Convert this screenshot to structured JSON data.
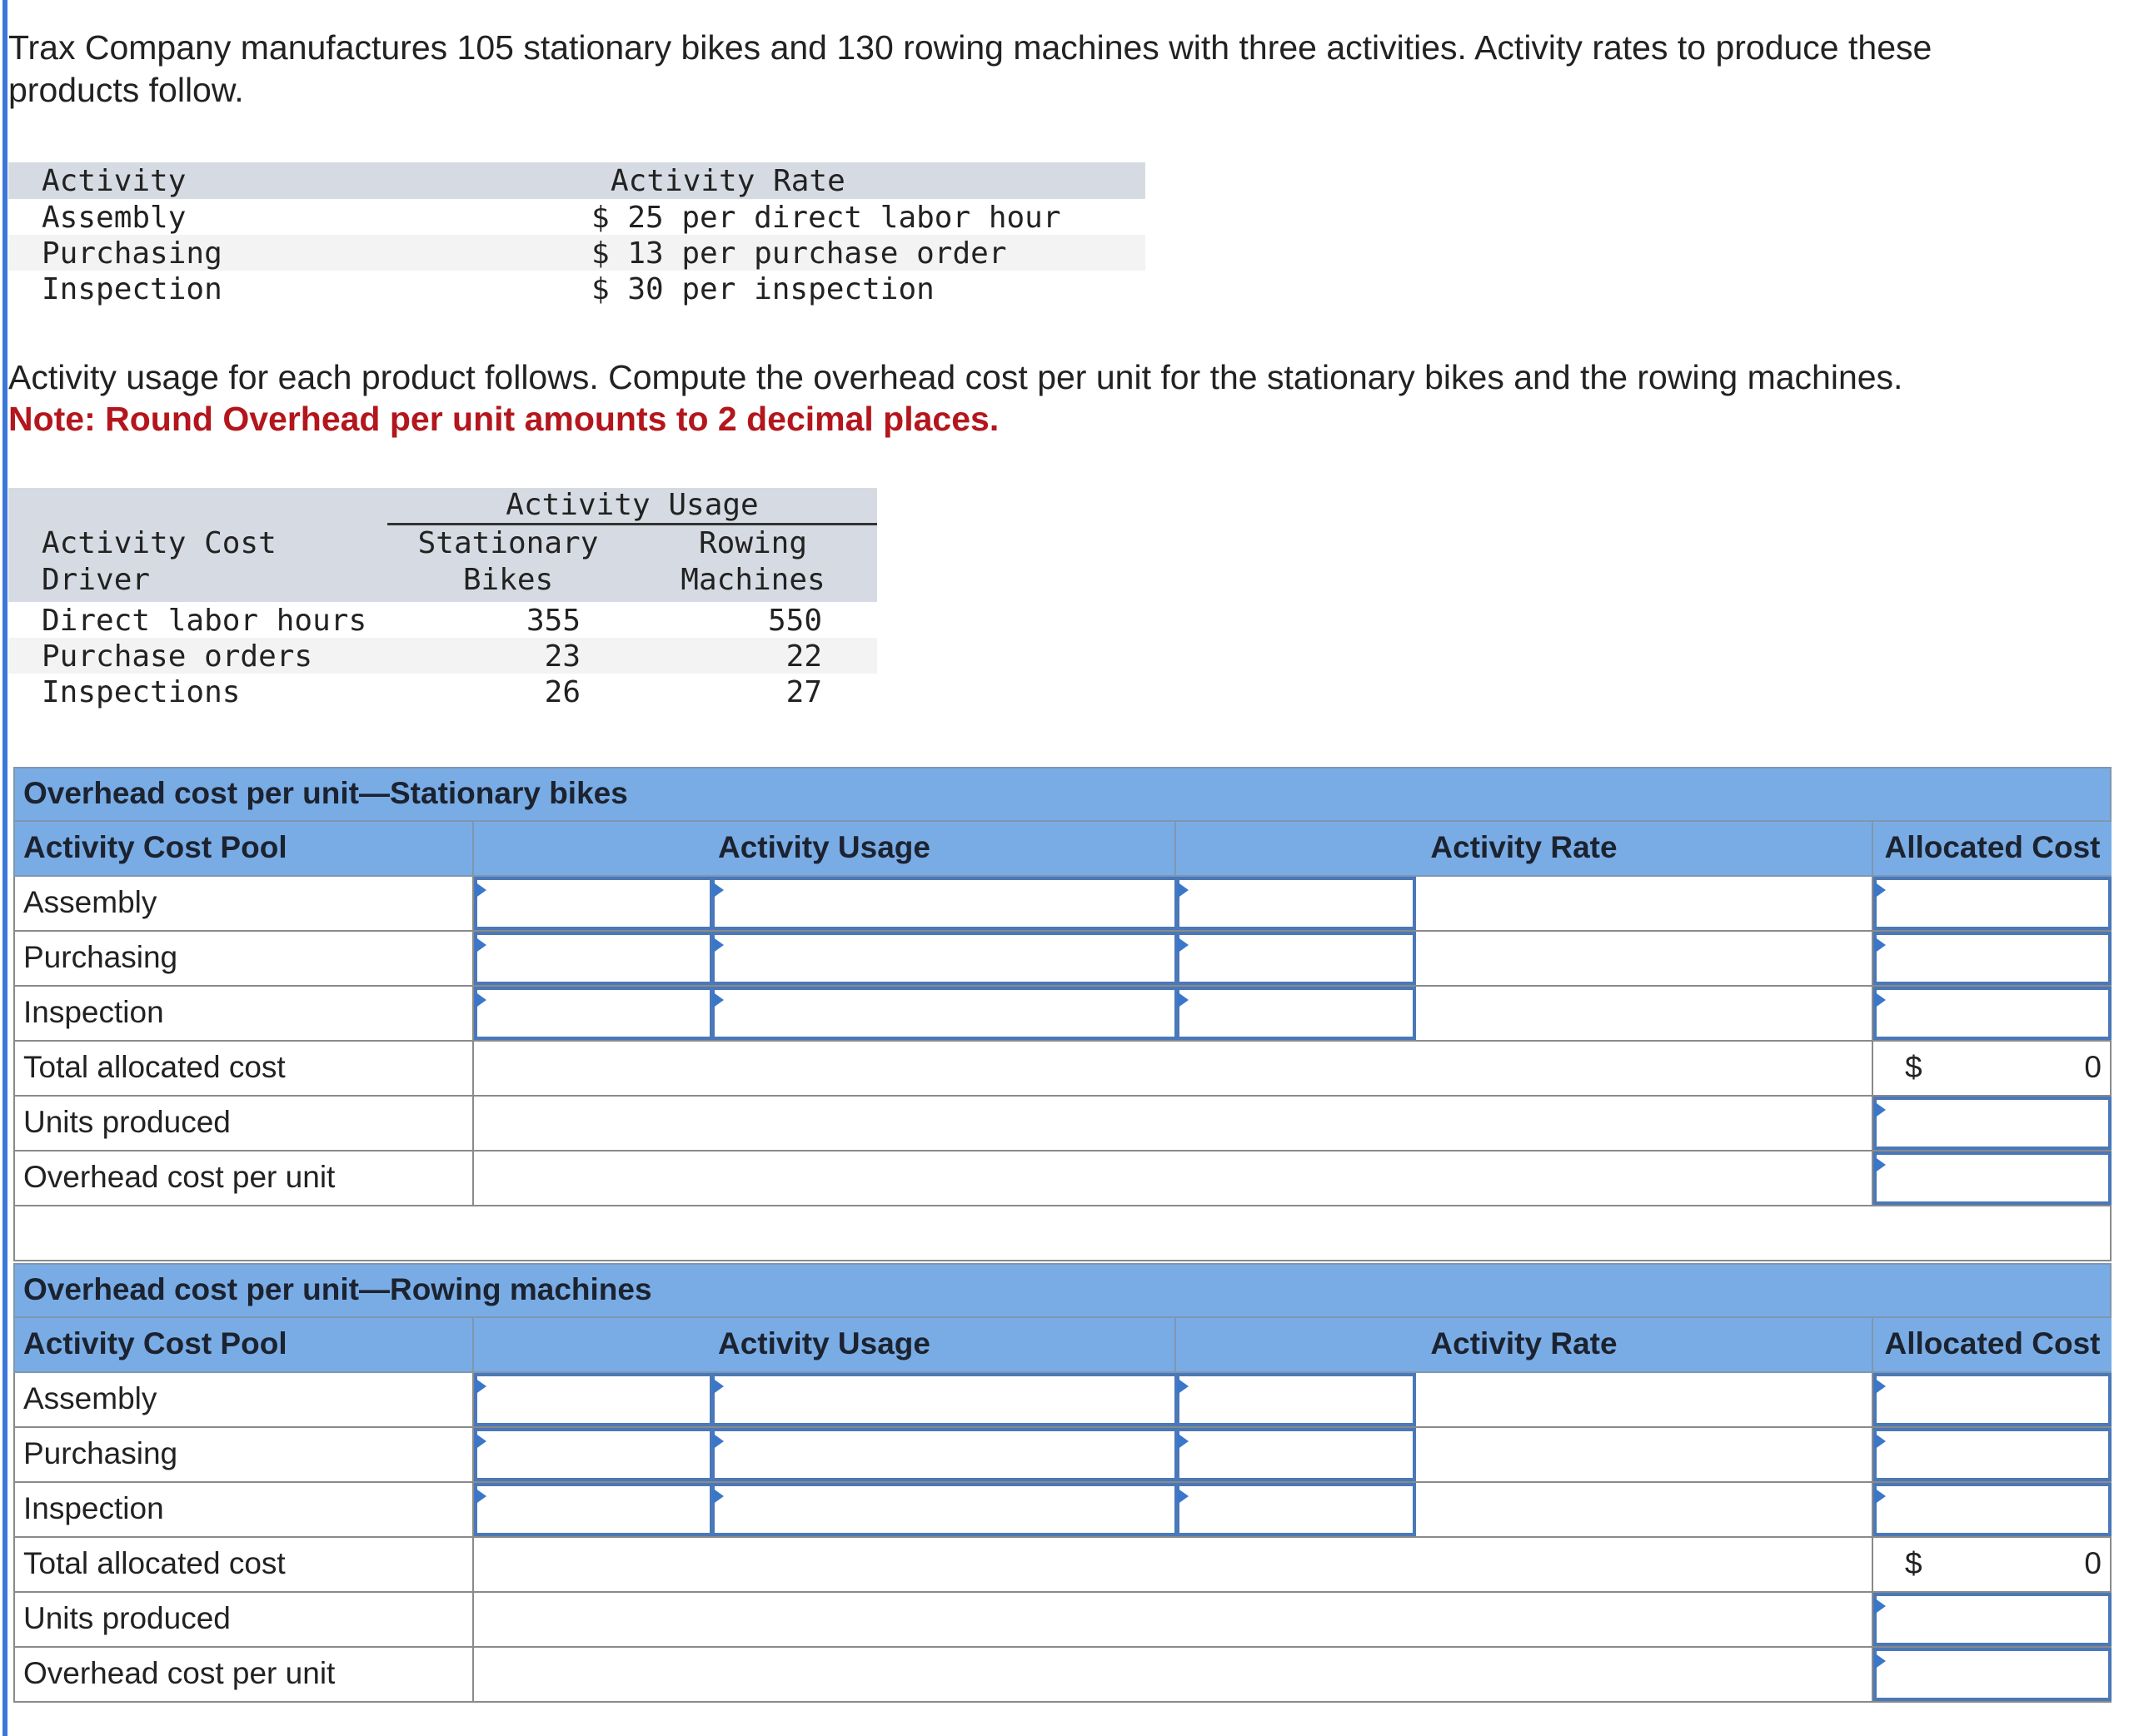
{
  "intro": {
    "line1": "Trax Company manufactures 105 stationary bikes and 130 rowing machines with three activities. Activity rates to produce these",
    "line2": "products follow."
  },
  "rate_table": {
    "headers": [
      "Activity",
      "Activity Rate"
    ],
    "rows": [
      {
        "activity": "Assembly",
        "rate": "$ 25 per direct labor hour"
      },
      {
        "activity": "Purchasing",
        "rate": "$ 13 per purchase order"
      },
      {
        "activity": "Inspection",
        "rate": "$ 30 per inspection"
      }
    ]
  },
  "usage_intro": {
    "line": "Activity usage for each product follows. Compute the overhead cost per unit for the stationary bikes and the rowing machines.",
    "note": "Note: Round Overhead per unit amounts to 2 decimal places."
  },
  "usage_table": {
    "group_header": "Activity Usage",
    "headers": [
      "Activity Cost\nDriver",
      "Stationary\nBikes",
      "Rowing\nMachines"
    ],
    "rows": [
      {
        "driver": "Direct labor hours",
        "bikes": "355",
        "rowing": "550"
      },
      {
        "driver": "Purchase orders",
        "bikes": "23",
        "rowing": "22"
      },
      {
        "driver": "Inspections",
        "bikes": "26",
        "rowing": "27"
      }
    ]
  },
  "tables": [
    {
      "title": "Overhead cost per unit—Stationary bikes",
      "headers": [
        "Activity Cost Pool",
        "Activity Usage",
        "Activity Rate",
        "Allocated Cost"
      ],
      "rows": [
        "Assembly",
        "Purchasing",
        "Inspection"
      ],
      "total_label": "Total allocated cost",
      "total_currency": "$",
      "total_value": "0",
      "units_label": "Units produced",
      "per_unit_label": "Overhead cost per unit"
    },
    {
      "title": "Overhead cost per unit—Rowing machines",
      "headers": [
        "Activity Cost Pool",
        "Activity Usage",
        "Activity Rate",
        "Allocated Cost"
      ],
      "rows": [
        "Assembly",
        "Purchasing",
        "Inspection"
      ],
      "total_label": "Total allocated cost",
      "total_currency": "$",
      "total_value": "0",
      "units_label": "Units produced",
      "per_unit_label": "Overhead cost per unit"
    }
  ],
  "colors": {
    "header_blue": "#79ace5",
    "input_border": "#4a78b8",
    "note_red": "#b3161c",
    "info_header_gray": "#d6dbe3"
  }
}
